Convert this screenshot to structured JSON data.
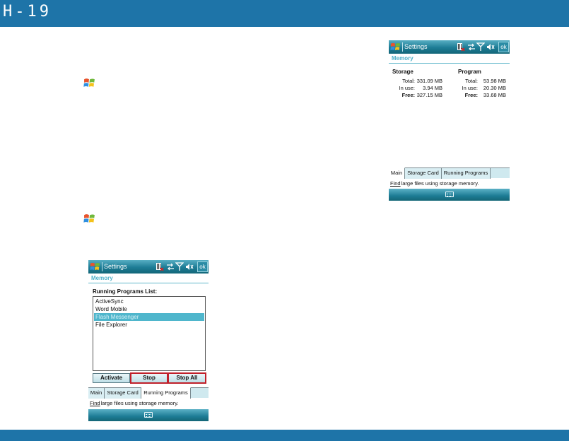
{
  "page": {
    "label": "H-19"
  },
  "colors": {
    "band": "#1e74a8",
    "highlight": "#c0202a",
    "title_bar": "#1d7c95"
  },
  "icons": {
    "start": "windows-flag-icon"
  },
  "screen1": {
    "title": "Settings",
    "ok": "ok",
    "subtitle": "Memory",
    "storage": {
      "heading": "Storage",
      "rows": [
        {
          "label": "Total:",
          "value": "331.09 MB"
        },
        {
          "label": "In use:",
          "value": "3.94 MB"
        },
        {
          "label": "Free:",
          "value": "327.15 MB"
        }
      ]
    },
    "program": {
      "heading": "Program",
      "rows": [
        {
          "label": "Total:",
          "value": "53.98 MB"
        },
        {
          "label": "In use:",
          "value": "20.30 MB"
        },
        {
          "label": "Free:",
          "value": "33.68 MB"
        }
      ]
    },
    "tabs": [
      "Main",
      "Storage Card",
      "Running Programs"
    ],
    "active_tab": "Main",
    "find_link": "Find",
    "find_text": "large files using storage memory."
  },
  "screen2": {
    "title": "Settings",
    "ok": "ok",
    "subtitle": "Memory",
    "list_heading": "Running Programs List:",
    "programs": [
      "ActiveSync",
      "Word Mobile",
      "Flash Messenger",
      "File Explorer"
    ],
    "selected_program": "Flash Messenger",
    "buttons": {
      "activate": "Activate",
      "stop": "Stop",
      "stop_all": "Stop All"
    },
    "tabs": [
      "Main",
      "Storage Card",
      "Running Programs"
    ],
    "active_tab": "Running Programs",
    "find_link": "Find",
    "find_text": "large files using storage memory."
  }
}
